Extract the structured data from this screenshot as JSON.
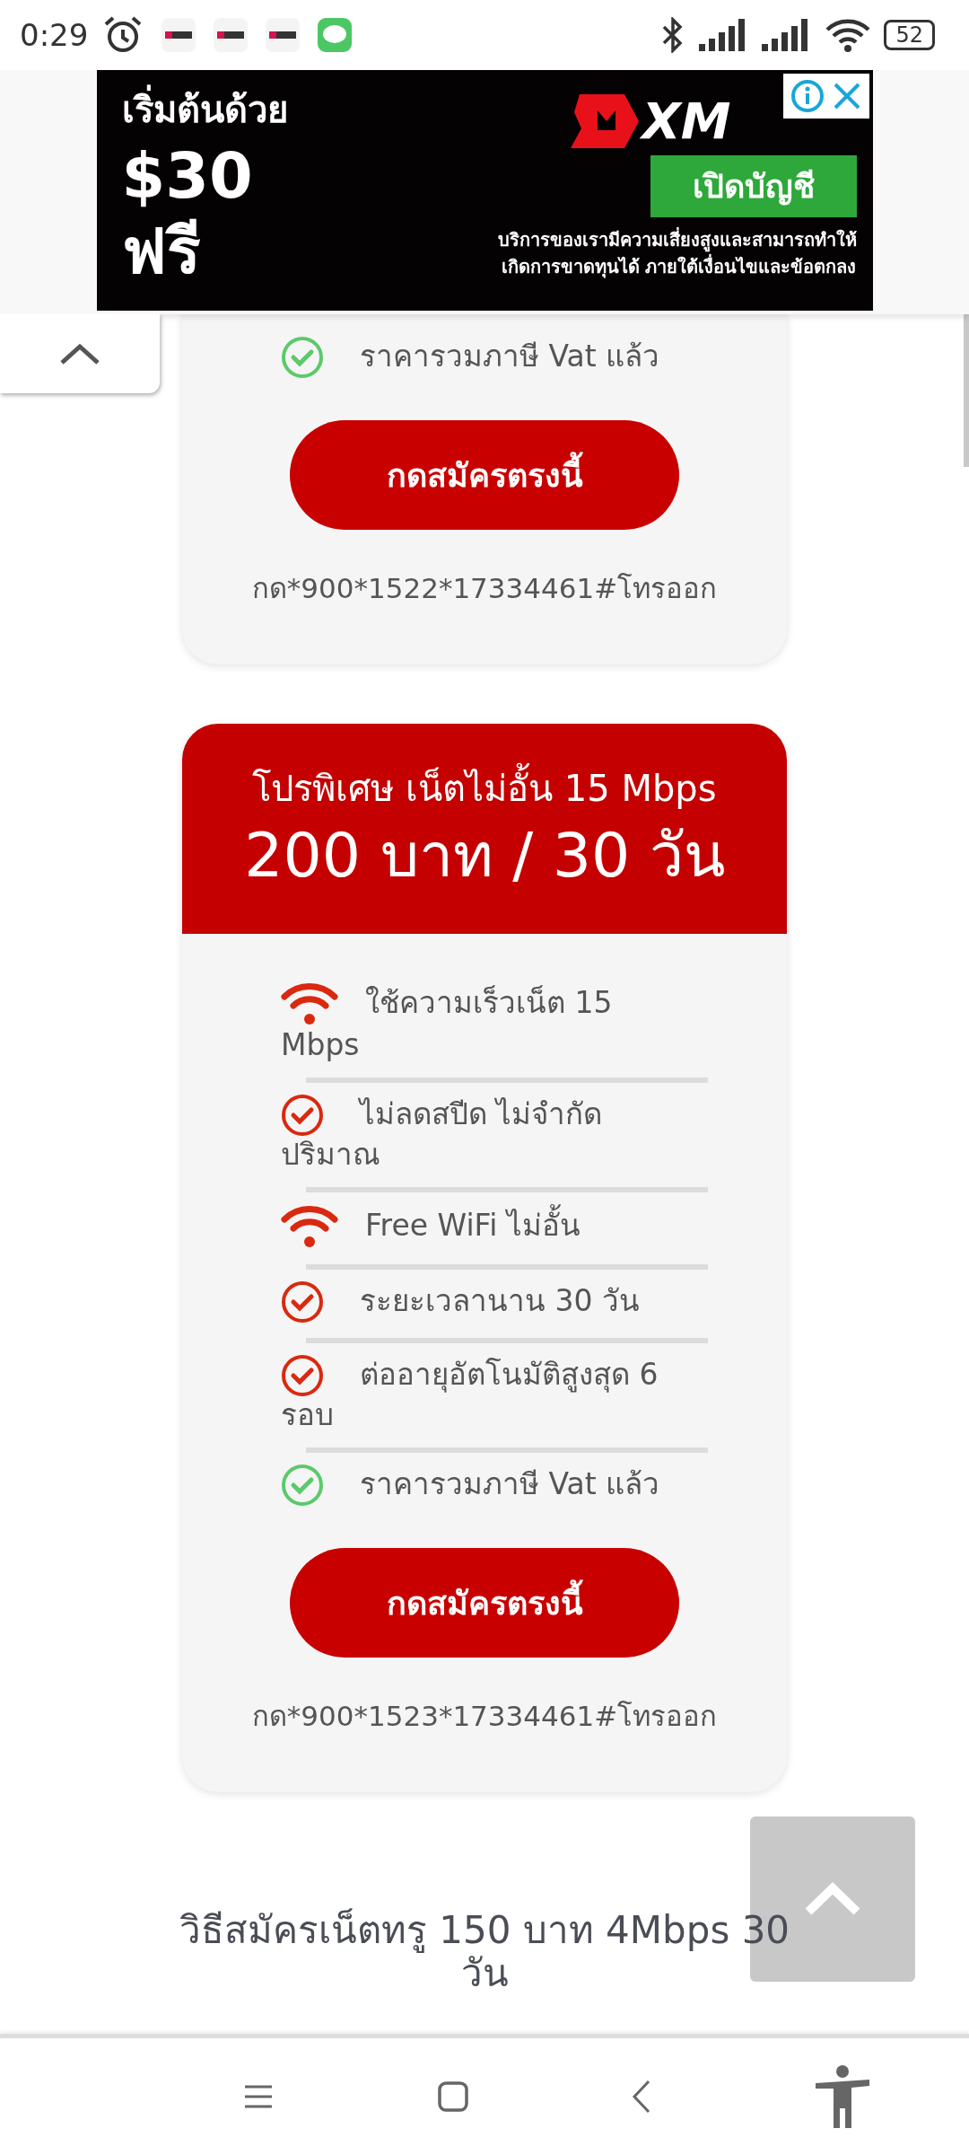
{
  "status_bar": {
    "time": "0:29",
    "battery": "52"
  },
  "ad": {
    "headline": "เริ่มต้นด้วย",
    "amount": "$30",
    "free": "ฟรี",
    "brand": "XM",
    "cta": "เปิดบัญชี",
    "disclaimer": [
      "บริการของเรามีความเสี่ยงสูงและสามารถทำให้",
      "เกิดการขาดทุนได้ ภายใต้เงื่อนไขและข้อตกลง"
    ]
  },
  "cards": [
    {
      "features": [
        {
          "kind": "check",
          "color": "#5cc96b",
          "text": "ราคารวมภาษี Vat แล้ว"
        }
      ],
      "button": "กดสมัครตรงนี้",
      "dial": "กด*900*1522*17334461#โทรออก"
    },
    {
      "title": "โปรพิเศษ เน็ตไม่อั้น 15 Mbps",
      "price": "200 บาท / 30 วัน",
      "features": [
        {
          "kind": "wifi",
          "color": "#d9290f",
          "text": "ใช้ความเร็วเน็ต 15 Mbps"
        },
        {
          "kind": "check",
          "color": "#d9290f",
          "text": "ไม่ลดสปีด ไม่จำกัดปริมาณ"
        },
        {
          "kind": "wifi",
          "color": "#d9290f",
          "text": "Free WiFi ไม่อั้น"
        },
        {
          "kind": "check",
          "color": "#d9290f",
          "text": "ระยะเวลานาน 30 วัน"
        },
        {
          "kind": "check",
          "color": "#d9290f",
          "text": "ต่ออายุอัตโนมัติสูงสุด 6 รอบ"
        },
        {
          "kind": "check",
          "color": "#5cc96b",
          "text": "ราคารวมภาษี Vat แล้ว"
        }
      ],
      "button": "กดสมัครตรงนี้",
      "dial": "กด*900*1523*17334461#โทรออก"
    }
  ],
  "heading": "วิธีสมัครเน็ตทรู 150 บาท 4Mbps 30 วัน"
}
